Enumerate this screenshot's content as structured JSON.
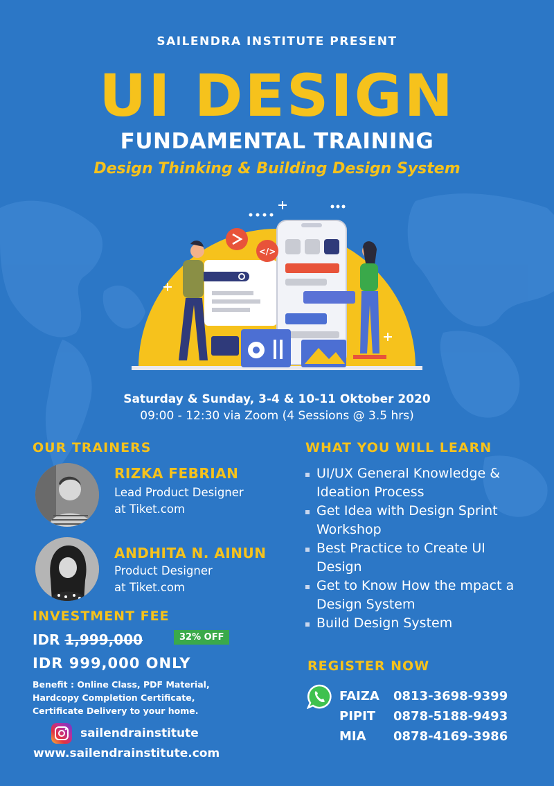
{
  "header": {
    "presenter": "SAILENDRA INSTITUTE PRESENT",
    "title": "UI DESIGN",
    "subtitle": "FUNDAMENTAL TRAINING",
    "tagline": "Design Thinking & Building Design System"
  },
  "schedule": {
    "dates": "Saturday & Sunday, 3-4 & 10-11 Oktober 2020",
    "time": "09:00 - 12:30 via Zoom (4 Sessions @ 3.5 hrs)"
  },
  "trainers": {
    "heading": "OUR TRAINERS",
    "items": [
      {
        "name": "RIZKA FEBRIAN",
        "role": "Lead Product Designer",
        "company": "at Tiket.com"
      },
      {
        "name": "ANDHITA N. AINUN",
        "role": "Product Designer",
        "company": "at Tiket.com"
      }
    ]
  },
  "learn": {
    "heading": "WHAT YOU WILL LEARN",
    "items": [
      "UI/UX General Knowledge & Ideation Process",
      "Get Idea with Design Sprint Workshop",
      "Best Practice to Create UI Design",
      "Get to Know How the mpact a Design System",
      "Build Design System"
    ]
  },
  "fee": {
    "heading": "INVESTMENT FEE",
    "currency": "IDR",
    "old_price": "1,999,000",
    "discount": "32% OFF",
    "new_price": "IDR 999,000 ONLY",
    "benefit": "Benefit : Online Class, PDF Material, Hardcopy Completion Certificate, Certificate Delivery to your home."
  },
  "register": {
    "heading": "REGISTER NOW",
    "contacts": [
      {
        "name": "FAIZA",
        "phone": "0813-3698-9399"
      },
      {
        "name": "PIPIT",
        "phone": "0878-5188-9493"
      },
      {
        "name": "MIA",
        "phone": "0878-4169-3986"
      }
    ]
  },
  "footer": {
    "instagram": "sailendrainstitute",
    "website": "www.sailendrainstitute.com"
  },
  "colors": {
    "background": "#2c77c6",
    "accent": "#f6c21c",
    "badge": "#3aa94a"
  },
  "icons": [
    "instagram-icon",
    "whatsapp-icon",
    "share-icon",
    "code-icon",
    "gear-icon",
    "search-icon"
  ]
}
